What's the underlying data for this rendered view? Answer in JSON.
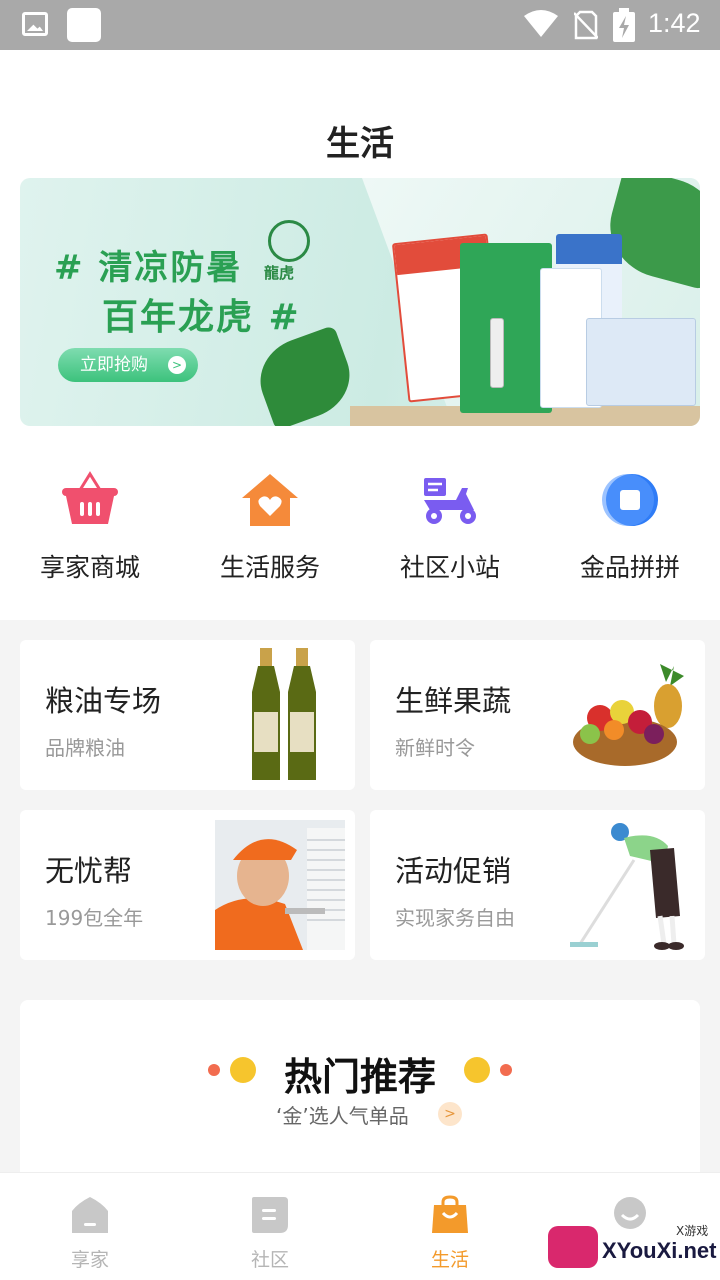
{
  "status_bar": {
    "time": "1:42"
  },
  "header": {
    "title": "生活"
  },
  "banner": {
    "line1": "# 清凉防暑",
    "line2": "百年龙虎 #",
    "brand": "龍虎",
    "button_label": "立即抢购",
    "button_arrow": ">"
  },
  "quick_nav": [
    {
      "label": "享家商城",
      "icon": "basket-icon",
      "color": "#f0506e"
    },
    {
      "label": "生活服务",
      "icon": "home-heart-icon",
      "color": "#f58a3a"
    },
    {
      "label": "社区小站",
      "icon": "scooter-icon",
      "color": "#7a5cf0"
    },
    {
      "label": "金品拼拼",
      "icon": "square-circle-icon",
      "color": "#2f7cf6"
    }
  ],
  "cards": [
    {
      "title": "粮油专场",
      "subtitle": "品牌粮油"
    },
    {
      "title": "生鲜果蔬",
      "subtitle": "新鲜时令"
    },
    {
      "title": "无忧帮",
      "subtitle": "199包全年"
    },
    {
      "title": "活动促销",
      "subtitle": "实现家务自由"
    }
  ],
  "recommend": {
    "title": "热门推荐",
    "subtitle": "‘金’选人气单品",
    "arrow": ">"
  },
  "bottom_nav": [
    {
      "label": "享家",
      "icon": "home-icon",
      "active": false
    },
    {
      "label": "社区",
      "icon": "community-icon",
      "active": false
    },
    {
      "label": "生活",
      "icon": "shopping-bag-icon",
      "active": true
    },
    {
      "label": "",
      "icon": "profile-icon",
      "active": false
    }
  ],
  "watermark": {
    "text": "XYouXi.net",
    "small": "X游戏"
  },
  "colors": {
    "accent": "#f39a2b",
    "inactive": "#b5b5b5",
    "banner_green": "#2aa053"
  }
}
